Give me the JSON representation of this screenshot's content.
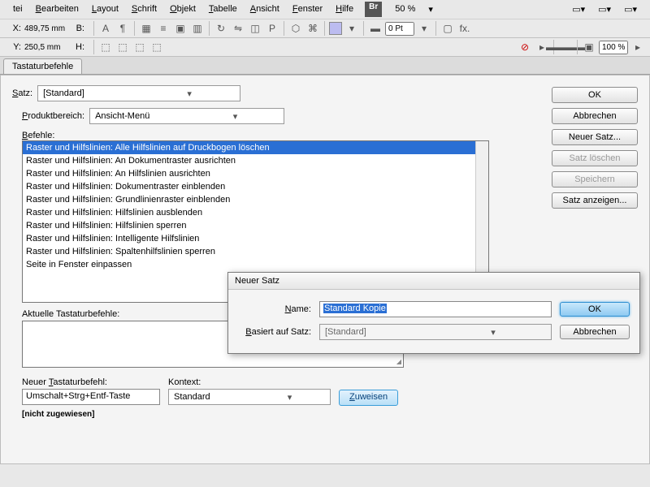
{
  "menu": {
    "items": [
      "tei",
      "Bearbeiten",
      "Layout",
      "Schrift",
      "Objekt",
      "Tabelle",
      "Ansicht",
      "Fenster",
      "Hilfe"
    ],
    "br": "Br",
    "zoom": "50 %"
  },
  "coords": {
    "x_label": "X:",
    "x_val": "489,75 mm",
    "b_label": "B:",
    "y_label": "Y:",
    "y_val": "250,5 mm",
    "h_label": "H:"
  },
  "toolbar": {
    "pt_value": "0 Pt",
    "pct_value": "100 %"
  },
  "tab_title": "Tastaturbefehle",
  "dialog": {
    "satz_label": "Satz:",
    "satz_value": "[Standard]",
    "bereich_label": "Produktbereich:",
    "bereich_value": "Ansicht-Menü",
    "commands_label": "Befehle:",
    "commands": [
      "Raster und Hilfslinien: Alle Hilfslinien auf Druckbogen löschen",
      "Raster und Hilfslinien: An Dokumentraster ausrichten",
      "Raster und Hilfslinien: An Hilfslinien ausrichten",
      "Raster und Hilfslinien: Dokumentraster einblenden",
      "Raster und Hilfslinien: Grundlinienraster einblenden",
      "Raster und Hilfslinien: Hilfslinien ausblenden",
      "Raster und Hilfslinien: Hilfslinien sperren",
      "Raster und Hilfslinien: Intelligente Hilfslinien",
      "Raster und Hilfslinien: Spaltenhilfslinien sperren",
      "Seite in Fenster einpassen"
    ],
    "current_label": "Aktuelle Tastaturbefehle:",
    "new_shortcut_label": "Neuer Tastaturbefehl:",
    "new_shortcut_value": "Umschalt+Strg+Entf-Taste",
    "context_label": "Kontext:",
    "context_value": "Standard",
    "assign_label": "Zuweisen",
    "unassigned": "[nicht zugewiesen]",
    "buttons": {
      "ok": "OK",
      "cancel": "Abbrechen",
      "new_set": "Neuer Satz...",
      "delete_set": "Satz löschen",
      "save": "Speichern",
      "show_set": "Satz anzeigen..."
    }
  },
  "modal": {
    "title": "Neuer Satz",
    "name_label": "Name:",
    "name_value": "Standard Kopie",
    "based_label": "Basiert auf Satz:",
    "based_value": "[Standard]",
    "ok": "OK",
    "cancel": "Abbrechen"
  }
}
